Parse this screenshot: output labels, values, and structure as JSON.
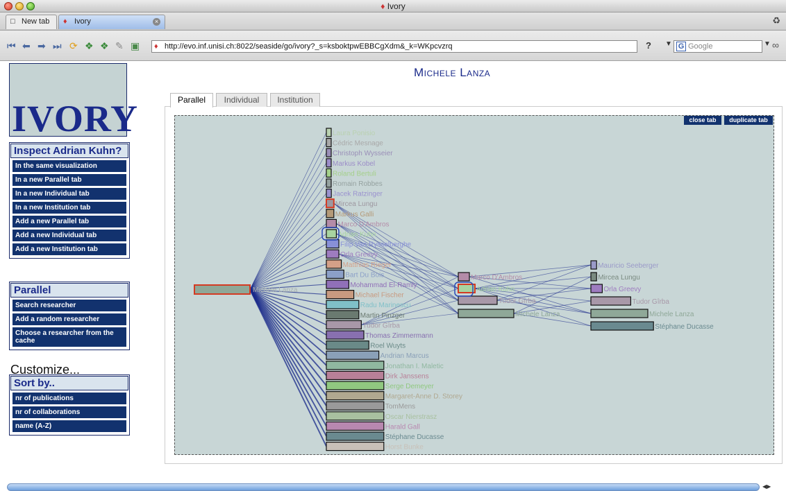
{
  "window": {
    "title": "Ivory"
  },
  "browser_tabs": [
    {
      "label": "New tab",
      "active": false
    },
    {
      "label": "Ivory",
      "active": true
    }
  ],
  "toolbar": {
    "url": "http://evo.inf.unisi.ch:8022/seaside/go/ivory?_s=ksboktpwEBBCgXdm&_k=WKpcvzrq",
    "help": "?",
    "search_placeholder": "Google"
  },
  "sidebar": {
    "logo": "Ivory",
    "inspect": {
      "heading": "Inspect Adrian Kuhn?",
      "items": [
        "In the same visualization",
        "In a new Parallel tab",
        "In a new Individual tab",
        "In a new Institution tab",
        "Add a new Parallel tab",
        "Add a new Individual tab",
        "Add a new Institution tab"
      ]
    },
    "parallel": {
      "heading": "Parallel",
      "items": [
        "Search researcher",
        "Add a random researcher",
        "Choose a researcher from the cache"
      ]
    },
    "customize": "Customize...",
    "sortby": {
      "heading": "Sort by..",
      "items": [
        "nr of publications",
        "nr of collaborations",
        "name (A-Z)"
      ]
    }
  },
  "main": {
    "title": "Michele Lanza",
    "tabs": [
      "Parallel",
      "Individual",
      "Institution"
    ],
    "close_tab": "close tab",
    "duplicate_tab": "duplicate tab"
  },
  "visualization": {
    "root": {
      "label": "Michele Lanza",
      "color": "#8fa898"
    },
    "column1": [
      {
        "name": "Laura Ponisio",
        "w": 1,
        "color": "#b9d1b0"
      },
      {
        "name": "Cédric Mesnage",
        "w": 1,
        "color": "#a8a8a8"
      },
      {
        "name": "Christoph Wysseier",
        "w": 1,
        "color": "#9a8fb8"
      },
      {
        "name": "Markus Kobel",
        "w": 1,
        "color": "#9b8cc8"
      },
      {
        "name": "Roland Bertuli",
        "w": 1,
        "color": "#a4d08a"
      },
      {
        "name": "Romain Robbes",
        "w": 1,
        "color": "#95a2a0"
      },
      {
        "name": "Jacek Ratzinger",
        "w": 2,
        "color": "#9a92cf"
      },
      {
        "name": "Mircea Lungu",
        "w": 3,
        "color": "#9d97a0"
      },
      {
        "name": "Markus Galli",
        "w": 3,
        "color": "#b49a78"
      },
      {
        "name": "Marco D'Ambros",
        "w": 4,
        "color": "#b48ca8"
      },
      {
        "name": "Adrian Kuhn",
        "w": 4,
        "color": "#a8d4a0"
      },
      {
        "name": "Filip Van Rysselberghe",
        "w": 5,
        "color": "#8890d8"
      },
      {
        "name": "Orla Greevy",
        "w": 5,
        "color": "#9e7cc0"
      },
      {
        "name": "Matthias Rieger",
        "w": 6,
        "color": "#d4a088"
      },
      {
        "name": "Bart Du Bois",
        "w": 7,
        "color": "#8ca0c8"
      },
      {
        "name": "Mohammad El-Ramly",
        "w": 9,
        "color": "#9070b8"
      },
      {
        "name": "Michael Fischer",
        "w": 11,
        "color": "#c89a80"
      },
      {
        "name": "Radu Marinescu",
        "w": 13,
        "color": "#80c0c8"
      },
      {
        "name": "Martin Pinzger",
        "w": 13,
        "color": "#6a7a70"
      },
      {
        "name": "Tudor Gîrba",
        "w": 14,
        "color": "#a898a8"
      },
      {
        "name": "Thomas Zimmermann",
        "w": 15,
        "color": "#8870b0"
      },
      {
        "name": "Roel Wuyts",
        "w": 17,
        "color": "#6a8a88"
      },
      {
        "name": "Andrian Marcus",
        "w": 21,
        "color": "#8aa0b8"
      },
      {
        "name": "Jonathan I. Maletic",
        "w": 23,
        "color": "#90b8a0"
      },
      {
        "name": "Dirk Janssens",
        "w": 23,
        "color": "#b88098"
      },
      {
        "name": "Serge Demeyer",
        "w": 23,
        "color": "#90c880"
      },
      {
        "name": "Margaret-Anne D. Storey",
        "w": 23,
        "color": "#b0a890"
      },
      {
        "name": "TomMens",
        "w": 23,
        "color": "#9a9a9a"
      },
      {
        "name": "Oscar Nierstrasz",
        "w": 23,
        "color": "#a8c0a0"
      },
      {
        "name": "Harald Gall",
        "w": 23,
        "color": "#b888b0"
      },
      {
        "name": "Stéphane Ducasse",
        "w": 23,
        "color": "#6a8a90"
      },
      {
        "name": "Horst Bunke",
        "w": 23,
        "color": "#c8c0b8"
      }
    ],
    "column2": [
      {
        "name": "Marco D'Ambros",
        "w": 2,
        "color": "#b48ca8"
      },
      {
        "name": "Adrian Kuhn",
        "w": 3,
        "color": "#a8d4a0"
      },
      {
        "name": "Tudor Gîrba",
        "w": 7,
        "color": "#a898a8"
      },
      {
        "name": "Michele Lanza",
        "w": 10,
        "color": "#8fa898"
      }
    ],
    "column3": [
      {
        "name": "Mauricio Seeberger",
        "w": 1,
        "color": "#9a9ac8"
      },
      {
        "name": "Mircea Lungu",
        "w": 1,
        "color": "#7a8a80"
      },
      {
        "name": "Orla Greevy",
        "w": 2,
        "color": "#9e7cc0"
      },
      {
        "name": "Tudor Gîrba",
        "w": 7,
        "color": "#a898a8"
      },
      {
        "name": "Michele Lanza",
        "w": 10,
        "color": "#8fa898"
      },
      {
        "name": "Stéphane Ducasse",
        "w": 11,
        "color": "#6a8a90"
      }
    ]
  }
}
